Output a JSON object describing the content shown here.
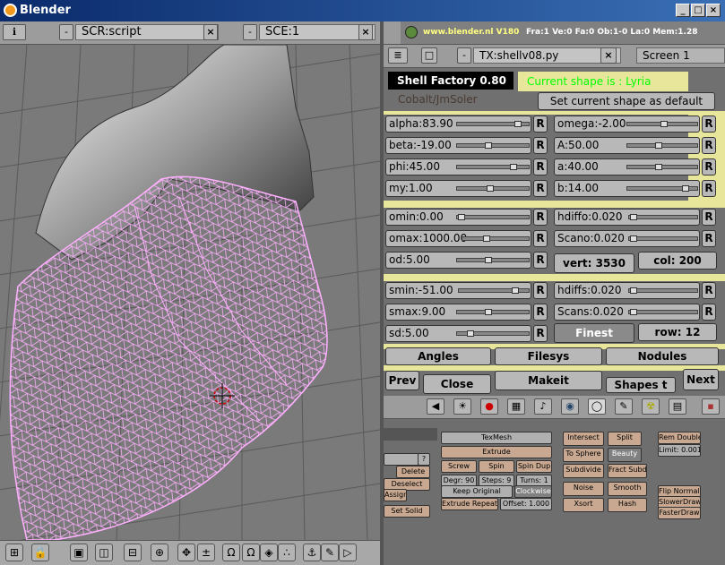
{
  "window": {
    "title": "Blender",
    "min": "_",
    "max": "□",
    "close": "×"
  },
  "left_header": {
    "screen": "SCR:script",
    "scene": "SCE:1",
    "close": "×"
  },
  "info": {
    "url": "www.blender.nl",
    "version": "V180",
    "stats": "Fra:1  Ve:0 Fa:0  Ob:1-0 La:0  Mem:1.28"
  },
  "text_header": {
    "file": "TX:shellv08.py",
    "close": "×",
    "screen": "Screen 1"
  },
  "script": {
    "title": "Shell Factory 0.80",
    "author": "Cobalt/JmSoler",
    "current_shape": "Current shape is  : Lyria",
    "set_default": "Set current shape as default",
    "sliders_left": [
      "alpha:83.90",
      "beta:-19.00",
      "phi:45.00",
      "my:1.00",
      "omin:0.00",
      "omax:1000.00",
      "od:5.00",
      "smin:-51.00",
      "smax:9.00",
      "sd:5.00"
    ],
    "sliders_right": [
      "omega:-2.00",
      "A:50.00",
      "a:40.00",
      "b:14.00",
      "hdiffo:0.020",
      "Scano:0.020",
      "hdiffs:0.020",
      "Scans:0.020"
    ],
    "reset_label": "R",
    "vert": "vert: 3530",
    "col": "col: 200",
    "finest": "Finest",
    "row": "row: 12",
    "tabs": [
      "Angles",
      "Filesys",
      "Nodules"
    ],
    "prev": "Prev",
    "close": "Close",
    "makeit": "Makeit",
    "shapes": "Shapes t",
    "next": "Next"
  },
  "mesh_buttons": {
    "texmesh": "TexMesh",
    "extrude": "Extrude",
    "screw": "Screw",
    "spin": "Spin",
    "spin_dup": "Spin Dup",
    "degr": "Degr: 90",
    "steps": "Steps: 9",
    "turns": "Turns: 1",
    "keep_original": "Keep Original",
    "clockwise": "Clockwise",
    "extrude_repeat": "Extrude Repeat",
    "offset": "Offset: 1.000",
    "intersect": "Intersect",
    "split": "Split",
    "to_sphere": "To Sphere",
    "beauty": "Beauty",
    "subdivide": "Subdivide",
    "fract_subd": "Fract Subd",
    "noise": "Noise",
    "smooth": "Smooth",
    "xsort": "Xsort",
    "hash": "Hash",
    "rem_doubles": "Rem Doubles",
    "limit": "Limit: 0.001",
    "flip_normals": "Flip Normals",
    "slower_draw": "SlowerDraw",
    "faster_draw": "FasterDraw",
    "delete": "Delete",
    "deselect": "Deselect",
    "assign": "Assign",
    "set_solid": "Set Solid"
  },
  "colors": {
    "accent": "#e8e69a",
    "wire": "#ffb0ff",
    "panel": "#707070"
  }
}
